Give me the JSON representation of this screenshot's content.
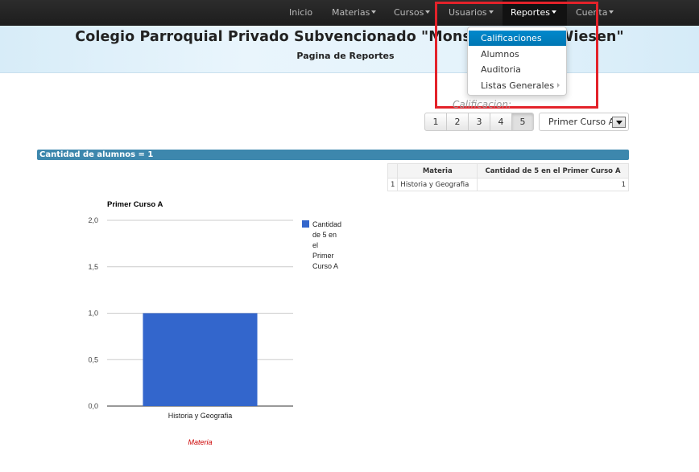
{
  "navbar": {
    "items": [
      {
        "label": "Inicio",
        "caret": false,
        "active": false
      },
      {
        "label": "Materias",
        "caret": true,
        "active": false
      },
      {
        "label": "Cursos",
        "caret": true,
        "active": false
      },
      {
        "label": "Usuarios",
        "caret": true,
        "active": false
      },
      {
        "label": "Reportes",
        "caret": true,
        "active": true
      },
      {
        "label": "Cuenta",
        "caret": true,
        "active": false
      }
    ]
  },
  "header": {
    "title": "Colegio Parroquial Privado Subvencionado \"Mons",
    "title_end": "Wiesen\"",
    "subtitle": "Pagina de Reportes"
  },
  "dropdown": {
    "items": [
      {
        "label": "Calificaciones",
        "active": true
      },
      {
        "label": "Alumnos",
        "active": false
      },
      {
        "label": "Auditoria",
        "active": false
      },
      {
        "label": "Listas Generales",
        "active": false,
        "submenu": true
      }
    ]
  },
  "calificacion": {
    "label": "Calificacion:",
    "grades": [
      "1",
      "2",
      "3",
      "4",
      "5"
    ],
    "selected_grade": "5",
    "course_select": "Primer Curso A"
  },
  "summary": {
    "count_label": "Cantidad de alumnos = 1"
  },
  "table": {
    "headers": [
      "",
      "Materia",
      "Cantidad de 5 en el Primer Curso A"
    ],
    "rows": [
      {
        "index": "1",
        "materia": "Historia y Geografia",
        "cantidad": "1"
      }
    ]
  },
  "chart_data": {
    "type": "bar",
    "title": "Primer Curso A",
    "categories": [
      "Historia y Geografia"
    ],
    "series": [
      {
        "name": "Cantidad de 5 en el Primer Curso A",
        "values": [
          1
        ]
      }
    ],
    "xlabel": "Materia",
    "ylabel": "",
    "ylim": [
      0,
      2
    ],
    "yticks": [
      "0,0",
      "0,5",
      "1,0",
      "1,5",
      "2,0"
    ],
    "legend_lines": [
      "Cantidad",
      "de 5 en",
      "el",
      "Primer",
      "Curso A"
    ],
    "bar_color": "#3366cc",
    "xlabel_color": "#cc0000",
    "legend": "right",
    "grid": true
  }
}
